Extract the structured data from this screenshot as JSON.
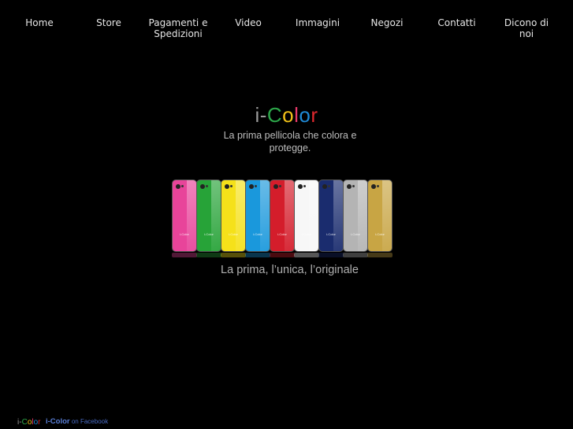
{
  "nav": {
    "items": [
      {
        "label": "Home"
      },
      {
        "label": "Store"
      },
      {
        "label": "Pagamenti e Spedizioni"
      },
      {
        "label": "Video"
      },
      {
        "label": "Immagini"
      },
      {
        "label": "Negozi"
      },
      {
        "label": "Contatti"
      },
      {
        "label": "Dicono di noi"
      }
    ]
  },
  "hero": {
    "brand_letters": [
      {
        "char": "i",
        "color": "#9a9a9a"
      },
      {
        "char": "-",
        "color": "#9a9a9a"
      },
      {
        "char": "C",
        "color": "#2da84a"
      },
      {
        "char": "o",
        "color": "#f2c318"
      },
      {
        "char": "l",
        "color": "#e8396a"
      },
      {
        "char": "o",
        "color": "#1f8ad6"
      },
      {
        "char": "r",
        "color": "#e0282e"
      }
    ],
    "tagline": "La prima pellicola che colora e protegge.",
    "slogan": "La prima, l’unica, l’originale"
  },
  "phones": [
    {
      "color": "#e8449a",
      "logo": "i-Color"
    },
    {
      "color": "#27a338",
      "logo": "i-Color"
    },
    {
      "color": "#f5e11a",
      "logo": "i-Color"
    },
    {
      "color": "#1a98dc",
      "logo": "i-Color"
    },
    {
      "color": "#d41d2b",
      "logo": "i-Color"
    },
    {
      "color": "#f7f7f7",
      "logo": "i-Color"
    },
    {
      "color": "#1a2c6e",
      "logo": "i-Color"
    },
    {
      "color": "#b4b4b4",
      "logo": "i-Color"
    },
    {
      "color": "#c8a544",
      "logo": "i-Color"
    }
  ],
  "footer": {
    "logo_letters": [
      {
        "char": "i",
        "color": "#9a9a9a"
      },
      {
        "char": "-",
        "color": "#9a9a9a"
      },
      {
        "char": "C",
        "color": "#2da84a"
      },
      {
        "char": "o",
        "color": "#f2c318"
      },
      {
        "char": "l",
        "color": "#e8396a"
      },
      {
        "char": "o",
        "color": "#1f8ad6"
      },
      {
        "char": "r",
        "color": "#e0282e"
      }
    ],
    "facebook_brand": "i-Color",
    "facebook_text": "on Facebook"
  }
}
